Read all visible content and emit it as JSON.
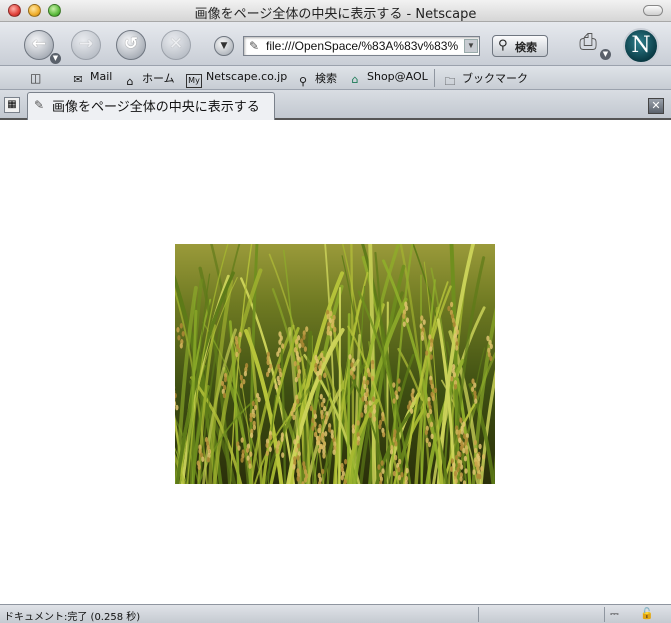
{
  "window": {
    "title": "画像をページ全体の中央に表示する - Netscape"
  },
  "navbar": {
    "back_icon": "back-arrow-icon",
    "forward_icon": "forward-arrow-icon",
    "reload_icon": "reload-icon",
    "stop_icon": "stop-icon",
    "url": "file:///OpenSpace/%83A%83v%83%",
    "search_label": "検索"
  },
  "personal_toolbar": {
    "items": [
      {
        "label": "Mail",
        "icon": "mail-icon"
      },
      {
        "label": "ホーム",
        "icon": "home-icon"
      },
      {
        "label": "Netscape.co.jp",
        "icon": "my-netscape-icon"
      },
      {
        "label": "検索",
        "icon": "search-icon"
      },
      {
        "label": "Shop@AOL",
        "icon": "shop-icon"
      },
      {
        "label": "ブックマーク",
        "icon": "folder-icon"
      }
    ]
  },
  "tabs": [
    {
      "label": "画像をページ全体の中央に表示する",
      "active": true
    }
  ],
  "content": {
    "image": "rice-field-photo"
  },
  "status": {
    "text": "ドキュメント:完了 (0.258 秒)"
  },
  "colors": {
    "toolbar": "#c9ced6",
    "netscape_logo": "#0a3b45"
  }
}
